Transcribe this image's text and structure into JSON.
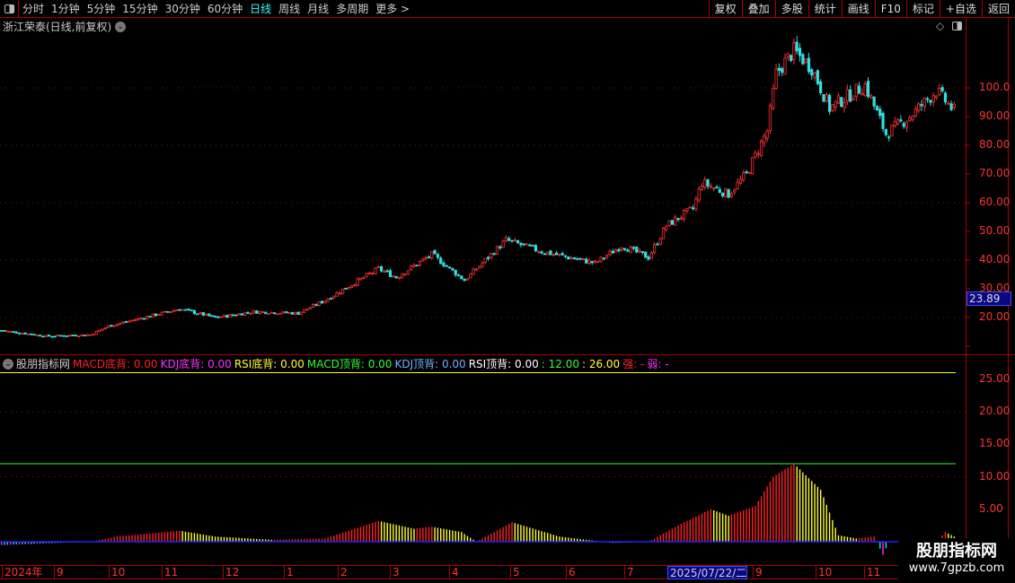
{
  "toolbar": {
    "periods": [
      "分时",
      "1分钟",
      "5分钟",
      "15分钟",
      "30分钟",
      "60分钟",
      "日线",
      "周线",
      "月线",
      "多周期",
      "更多 >"
    ],
    "active_period": "日线",
    "right_buttons": [
      "复权",
      "叠加",
      "多股",
      "统计",
      "画线",
      "F10",
      "标记",
      "+自选",
      "返回"
    ]
  },
  "chart_title": "浙江荣泰(日线,前复权)",
  "price_axis": {
    "ticks": [
      "100.0",
      "90.00",
      "80.00",
      "70.00",
      "60.00",
      "50.00",
      "40.00",
      "30.00",
      "20.00"
    ],
    "current_price": "23.89"
  },
  "indicator": {
    "name": "股朋指标网",
    "items": [
      {
        "text": "MACD底背: 0.00",
        "color": "#ff2020"
      },
      {
        "text": "KDJ底背: 0.00",
        "color": "#ff30ff"
      },
      {
        "text": "RSI底背: 0.00",
        "color": "#ffff30"
      },
      {
        "text": "MACD顶背: 0.00",
        "color": "#30ff30"
      },
      {
        "text": "KDJ顶背: 0.00",
        "color": "#70b0ff"
      },
      {
        "text": "RSI顶背: 0.00",
        "color": "#ffffff"
      },
      {
        "text": ": 12.00",
        "color": "#30ff30"
      },
      {
        "text": ": 26.00",
        "color": "#ffff30"
      },
      {
        "text": "强: -",
        "color": "#ff2020"
      },
      {
        "text": "弱: -",
        "color": "#ff30ff"
      }
    ],
    "axis_ticks": [
      "25.00",
      "20.00",
      "15.00",
      "10.00",
      "5.00"
    ],
    "levels": [
      {
        "value": 26,
        "color": "#ffff00"
      },
      {
        "value": 12,
        "color": "#30ff30"
      }
    ]
  },
  "time_axis": [
    "2024年",
    "9",
    "10",
    "11",
    "12",
    "1",
    "2",
    "3",
    "4",
    "5",
    "6",
    "7",
    "2025/07/22/二",
    "9",
    "10",
    "11"
  ],
  "chart_data": {
    "type": "candlestick",
    "bars": 322,
    "price_keyframes": [
      [
        0,
        15.5
      ],
      [
        15,
        13.5
      ],
      [
        30,
        14
      ],
      [
        36,
        17
      ],
      [
        60,
        23
      ],
      [
        72,
        20
      ],
      [
        85,
        22
      ],
      [
        100,
        21.5
      ],
      [
        109,
        26
      ],
      [
        127,
        37
      ],
      [
        133,
        34
      ],
      [
        145,
        42
      ],
      [
        156,
        33
      ],
      [
        170,
        47
      ],
      [
        182,
        43
      ],
      [
        200,
        39
      ],
      [
        209,
        45
      ],
      [
        218,
        41
      ],
      [
        224,
        52
      ],
      [
        233,
        58
      ],
      [
        236,
        67
      ],
      [
        245,
        63
      ],
      [
        251,
        70
      ],
      [
        258,
        85
      ],
      [
        261,
        105
      ],
      [
        267,
        113
      ],
      [
        273,
        107
      ],
      [
        279,
        93
      ],
      [
        285,
        97
      ],
      [
        291,
        101
      ],
      [
        298,
        84
      ],
      [
        306,
        90
      ],
      [
        315,
        99
      ],
      [
        321,
        92
      ]
    ],
    "indicator_keyframes": [
      [
        0,
        -0.5
      ],
      [
        30,
        0
      ],
      [
        39,
        0.8
      ],
      [
        60,
        1.7
      ],
      [
        72,
        0.8
      ],
      [
        91,
        0.3
      ],
      [
        109,
        0.5
      ],
      [
        127,
        3.2
      ],
      [
        139,
        2.0
      ],
      [
        145,
        2.3
      ],
      [
        155,
        1.5
      ],
      [
        160,
        0
      ],
      [
        172,
        3.0
      ],
      [
        188,
        0.8
      ],
      [
        206,
        -0.2
      ],
      [
        218,
        0
      ],
      [
        230,
        3.0
      ],
      [
        239,
        5.0
      ],
      [
        245,
        4.0
      ],
      [
        254,
        5.5
      ],
      [
        260,
        10
      ],
      [
        267,
        12
      ],
      [
        276,
        8
      ],
      [
        282,
        1
      ],
      [
        288,
        0.5
      ],
      [
        294,
        0.8
      ],
      [
        297,
        -2
      ],
      [
        299,
        0
      ],
      [
        315,
        0
      ],
      [
        318,
        1.5
      ],
      [
        321,
        0.8
      ]
    ],
    "price_ylim": [
      10,
      115
    ],
    "indicator_ylim": [
      -3,
      28
    ]
  },
  "watermark": {
    "title": "股朋指标网",
    "url": "www.7gpzb.com"
  }
}
